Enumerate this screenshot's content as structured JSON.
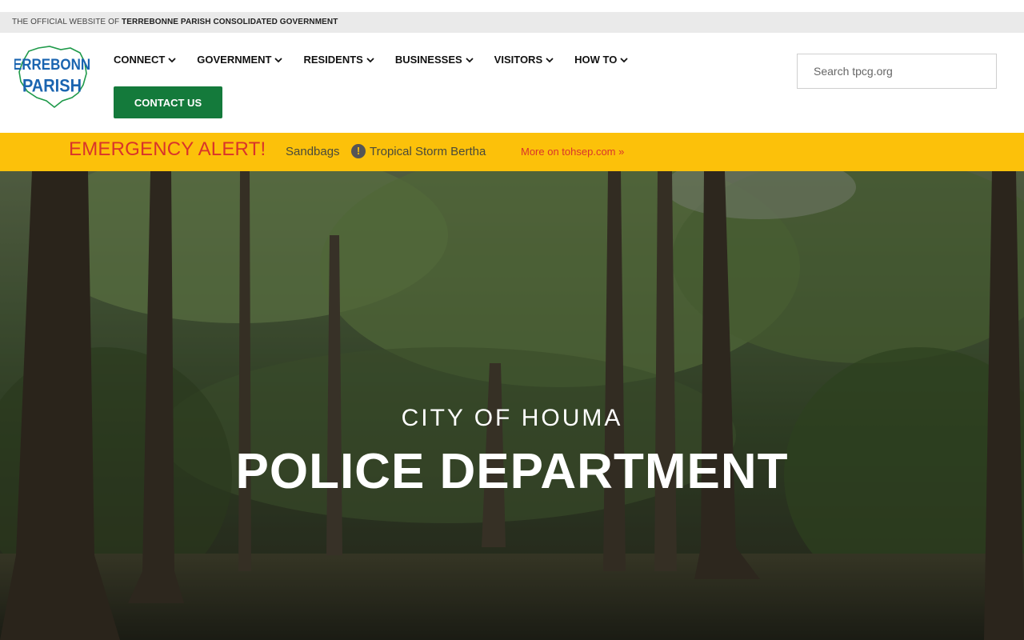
{
  "top_strip": {
    "prefix": "THE OFFICIAL WEBSITE OF ",
    "org": "TERREBONNE PARISH CONSOLIDATED GOVERNMENT"
  },
  "logo": {
    "line1": "TERREBONNE",
    "line2": "PARISH",
    "icon": "parish-map-logo"
  },
  "nav": {
    "items": [
      {
        "label": "CONNECT"
      },
      {
        "label": "GOVERNMENT"
      },
      {
        "label": "RESIDENTS"
      },
      {
        "label": "BUSINESSES"
      },
      {
        "label": "VISITORS"
      },
      {
        "label": "HOW TO"
      }
    ],
    "contact_label": "CONTACT US"
  },
  "search": {
    "placeholder": "Search tpcg.org"
  },
  "alert": {
    "title": "EMERGENCY ALERT!",
    "links": [
      "Sandbags",
      "Tropical Storm Bertha"
    ],
    "more": "More on tohsep.com »"
  },
  "hero": {
    "subtitle": "CITY OF HOUMA",
    "title": "POLICE DEPARTMENT"
  },
  "colors": {
    "accent_green": "#147a3b",
    "alert_yellow": "#fcc10a",
    "alert_red": "#d9342b",
    "logo_blue": "#1a64b0",
    "logo_green": "#1f9a4a"
  }
}
